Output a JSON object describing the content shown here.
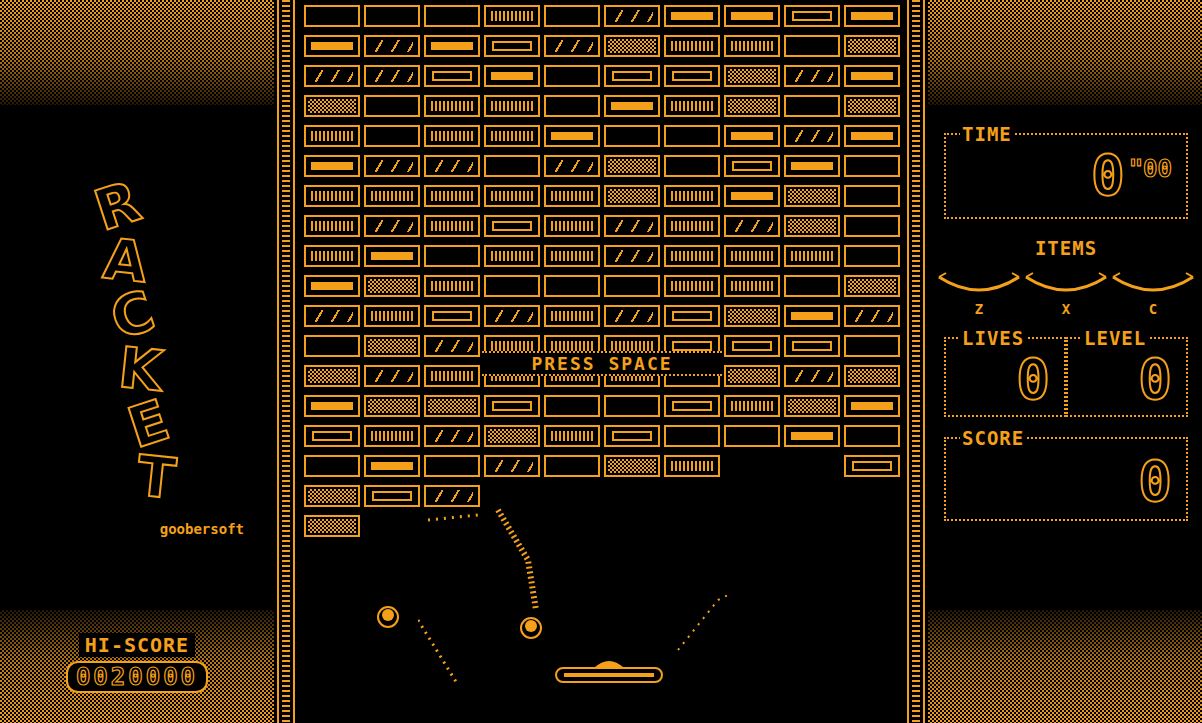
{
  "logo": {
    "title": "RACKET",
    "publisher": "goobersoft"
  },
  "hi_score": {
    "label": "HI-SCORE",
    "value": "0020000"
  },
  "prompt": "PRESS SPACE",
  "bricks": [
    [
      {
        "kind": "empty"
      },
      {
        "kind": "empty"
      },
      {
        "kind": "empty"
      },
      {
        "kind": "stripes"
      },
      {
        "kind": "empty"
      },
      {
        "kind": "slash"
      },
      {
        "kind": "bar"
      },
      {
        "kind": "bar"
      },
      {
        "kind": "double"
      },
      {
        "kind": "bar"
      }
    ],
    [
      {
        "kind": "bar"
      },
      {
        "kind": "slash"
      },
      {
        "kind": "bar"
      },
      {
        "kind": "double"
      },
      {
        "kind": "slash"
      },
      {
        "kind": "checker"
      },
      {
        "kind": "stripes"
      },
      {
        "kind": "stripes"
      },
      {
        "kind": "empty"
      },
      {
        "kind": "checker"
      }
    ],
    [
      {
        "kind": "slash"
      },
      {
        "kind": "slash"
      },
      {
        "kind": "double"
      },
      {
        "kind": "bar"
      },
      {
        "kind": "empty"
      },
      {
        "kind": "double"
      },
      {
        "kind": "double"
      },
      {
        "kind": "checker"
      },
      {
        "kind": "slash"
      },
      {
        "kind": "bar"
      }
    ],
    [
      {
        "kind": "checker"
      },
      {
        "kind": "empty"
      },
      {
        "kind": "stripes"
      },
      {
        "kind": "stripes"
      },
      {
        "kind": "empty"
      },
      {
        "kind": "bar"
      },
      {
        "kind": "stripes"
      },
      {
        "kind": "checker"
      },
      {
        "kind": "empty"
      },
      {
        "kind": "checker"
      }
    ],
    [
      {
        "kind": "stripes"
      },
      {
        "kind": "empty"
      },
      {
        "kind": "stripes"
      },
      {
        "kind": "stripes"
      },
      {
        "kind": "bar"
      },
      {
        "kind": "empty"
      },
      {
        "kind": "empty"
      },
      {
        "kind": "bar"
      },
      {
        "kind": "slash"
      },
      {
        "kind": "bar"
      }
    ],
    [
      {
        "kind": "bar"
      },
      {
        "kind": "slash"
      },
      {
        "kind": "slash"
      },
      {
        "kind": "empty"
      },
      {
        "kind": "slash"
      },
      {
        "kind": "checker"
      },
      {
        "kind": "empty"
      },
      {
        "kind": "double"
      },
      {
        "kind": "bar"
      },
      {
        "kind": "empty"
      }
    ],
    [
      {
        "kind": "stripes"
      },
      {
        "kind": "stripes"
      },
      {
        "kind": "stripes"
      },
      {
        "kind": "stripes"
      },
      {
        "kind": "stripes"
      },
      {
        "kind": "checker"
      },
      {
        "kind": "stripes"
      },
      {
        "kind": "bar"
      },
      {
        "kind": "checker"
      },
      {
        "kind": "empty"
      }
    ],
    [
      {
        "kind": "stripes"
      },
      {
        "kind": "slash"
      },
      {
        "kind": "stripes"
      },
      {
        "kind": "double"
      },
      {
        "kind": "stripes"
      },
      {
        "kind": "slash"
      },
      {
        "kind": "stripes"
      },
      {
        "kind": "slash"
      },
      {
        "kind": "checker"
      },
      {
        "kind": "empty"
      }
    ],
    [
      {
        "kind": "stripes"
      },
      {
        "kind": "bar"
      },
      {
        "kind": "empty"
      },
      {
        "kind": "stripes"
      },
      {
        "kind": "stripes"
      },
      {
        "kind": "slash"
      },
      {
        "kind": "stripes"
      },
      {
        "kind": "stripes"
      },
      {
        "kind": "stripes"
      },
      {
        "kind": "empty"
      }
    ],
    [
      {
        "kind": "bar"
      },
      {
        "kind": "checker"
      },
      {
        "kind": "stripes"
      },
      {
        "kind": "empty"
      },
      {
        "kind": "empty"
      },
      {
        "kind": "empty"
      },
      {
        "kind": "stripes"
      },
      {
        "kind": "stripes"
      },
      {
        "kind": "empty"
      },
      {
        "kind": "checker"
      }
    ],
    [
      {
        "kind": "slash"
      },
      {
        "kind": "stripes"
      },
      {
        "kind": "double"
      },
      {
        "kind": "slash"
      },
      {
        "kind": "stripes"
      },
      {
        "kind": "slash"
      },
      {
        "kind": "double"
      },
      {
        "kind": "checker"
      },
      {
        "kind": "bar"
      },
      {
        "kind": "slash"
      }
    ],
    [
      {
        "kind": "empty"
      },
      {
        "kind": "checker"
      },
      {
        "kind": "slash"
      },
      {
        "kind": "stripes"
      },
      {
        "kind": "stripes"
      },
      {
        "kind": "stripes"
      },
      {
        "kind": "double"
      },
      {
        "kind": "double"
      },
      {
        "kind": "double"
      },
      {
        "kind": "empty"
      }
    ],
    [
      {
        "kind": "checker"
      },
      {
        "kind": "slash"
      },
      {
        "kind": "stripes"
      },
      {
        "kind": "stripes"
      },
      {
        "kind": "stripes"
      },
      {
        "kind": "stripes"
      },
      {
        "kind": "empty"
      },
      {
        "kind": "checker"
      },
      {
        "kind": "slash"
      },
      {
        "kind": "checker"
      }
    ],
    [
      {
        "kind": "bar"
      },
      {
        "kind": "checker"
      },
      {
        "kind": "checker"
      },
      {
        "kind": "double"
      },
      {
        "kind": "empty"
      },
      {
        "kind": "empty"
      },
      {
        "kind": "double"
      },
      {
        "kind": "stripes"
      },
      {
        "kind": "checker"
      },
      {
        "kind": "bar"
      }
    ],
    [
      {
        "kind": "double"
      },
      {
        "kind": "stripes"
      },
      {
        "kind": "slash"
      },
      {
        "kind": "checker"
      },
      {
        "kind": "stripes"
      },
      {
        "kind": "double"
      },
      {
        "kind": "empty"
      },
      {
        "kind": "empty"
      },
      {
        "kind": "bar"
      },
      {
        "kind": "empty"
      }
    ],
    [
      {
        "kind": "empty"
      },
      {
        "kind": "bar"
      },
      {
        "kind": "empty"
      },
      {
        "kind": "slash"
      },
      {
        "kind": "empty"
      },
      {
        "kind": "checker"
      },
      {
        "kind": "stripes"
      },
      {
        "kind": "none"
      },
      {
        "kind": "none"
      },
      {
        "kind": "double"
      }
    ],
    [
      {
        "kind": "checker"
      },
      {
        "kind": "double"
      },
      {
        "kind": "slash"
      },
      {
        "kind": "none"
      },
      {
        "kind": "none"
      },
      {
        "kind": "none"
      },
      {
        "kind": "none"
      },
      {
        "kind": "none"
      },
      {
        "kind": "none"
      },
      {
        "kind": "none"
      }
    ],
    [
      {
        "kind": "checker"
      },
      {
        "kind": "none"
      },
      {
        "kind": "none"
      },
      {
        "kind": "none"
      },
      {
        "kind": "none"
      },
      {
        "kind": "none"
      },
      {
        "kind": "none"
      },
      {
        "kind": "none"
      },
      {
        "kind": "none"
      },
      {
        "kind": "none"
      }
    ]
  ],
  "time": {
    "label": "TIME",
    "seconds": "0",
    "hundredths": "\"00"
  },
  "items": {
    "label": "ITEMS",
    "slots": [
      {
        "key": "Z"
      },
      {
        "key": "X"
      },
      {
        "key": "C"
      }
    ]
  },
  "lives": {
    "label": "LIVES",
    "value": "0"
  },
  "level": {
    "label": "LEVEL",
    "value": "0"
  },
  "score": {
    "label": "SCORE",
    "value": "0"
  }
}
